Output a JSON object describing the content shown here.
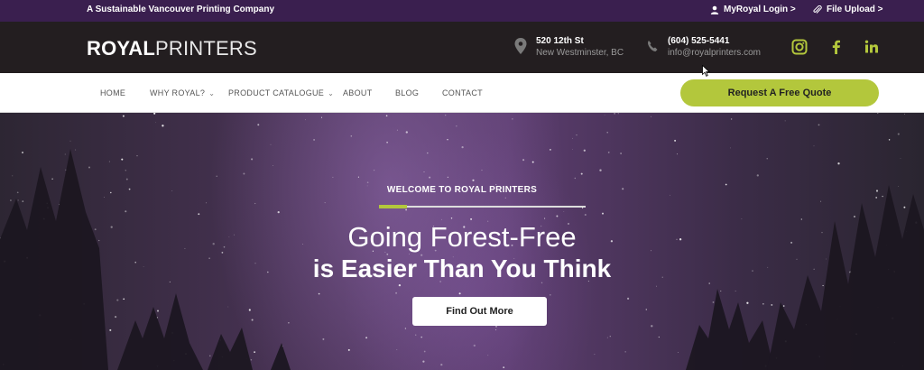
{
  "topbar": {
    "tagline": "A Sustainable Vancouver Printing Company",
    "login_label": "MyRoyal Login >",
    "upload_label": "File Upload >"
  },
  "header": {
    "logo_bold": "ROYAL",
    "logo_light": "PRINTERS",
    "address_line1": "520 12th St",
    "address_line2": "New Westminster, BC",
    "phone": "(604) 525-5441",
    "email": "info@royalprinters.com",
    "social": [
      "instagram-icon",
      "facebook-icon",
      "linkedin-icon"
    ]
  },
  "nav": {
    "items": [
      {
        "label": "HOME",
        "dropdown": false
      },
      {
        "label": "WHY ROYAL?",
        "dropdown": true
      },
      {
        "label": "PRODUCT CATALOGUE",
        "dropdown": true
      },
      {
        "label": "ABOUT",
        "dropdown": false
      },
      {
        "label": "BLOG",
        "dropdown": false
      },
      {
        "label": "CONTACT",
        "dropdown": false
      }
    ],
    "quote_button": "Request A Free Quote"
  },
  "hero": {
    "welcome": "WELCOME TO ROYAL PRINTERS",
    "headline_line1": "Going Forest-Free",
    "headline_line2": "is Easier Than You Think",
    "cta_label": "Find Out More"
  },
  "colors": {
    "topbar_bg": "#3a1f4f",
    "header_bg": "#231e20",
    "accent_green": "#b3c73c"
  }
}
